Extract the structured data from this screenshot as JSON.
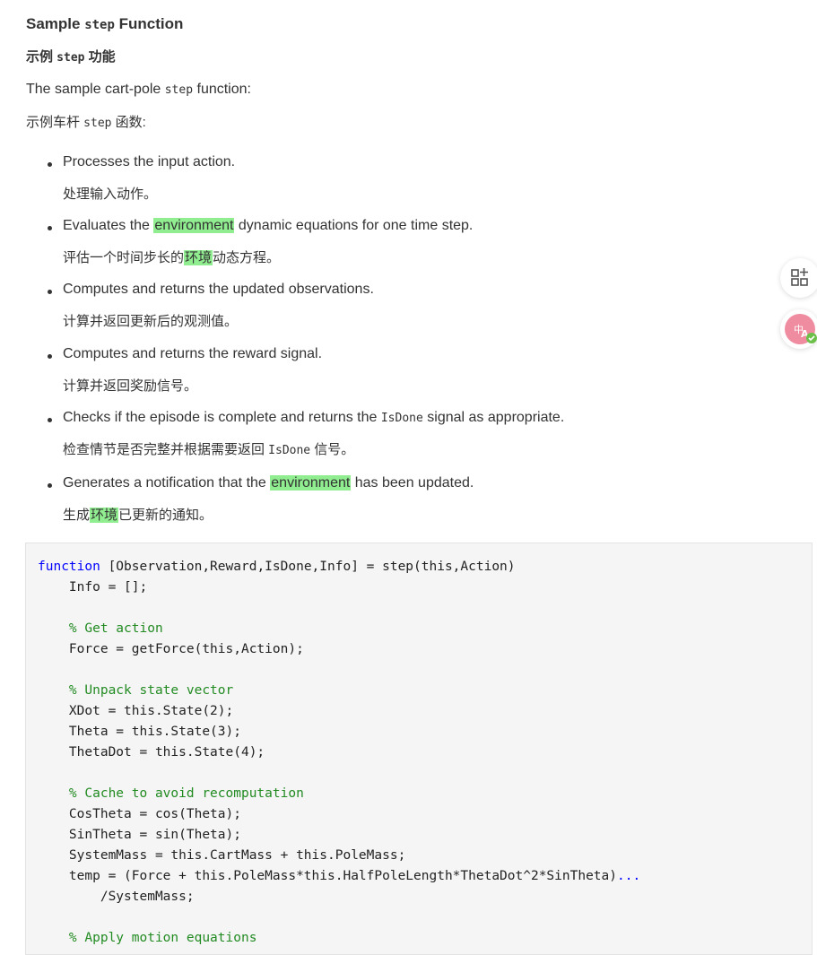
{
  "heading": {
    "en_before": "Sample ",
    "en_code": "step",
    "en_after": " Function",
    "zh_before": "示例 ",
    "zh_code": "step",
    "zh_after": " 功能"
  },
  "intro": {
    "en_before": "The sample cart-pole ",
    "en_code": "step",
    "en_after": " function:",
    "zh_before": "示例车杆 ",
    "zh_code": "step",
    "zh_after": " 函数:"
  },
  "bullets": [
    {
      "en": "Processes the input action.",
      "zh": "处理输入动作。"
    },
    {
      "en_before": "Evaluates the ",
      "en_mark": "environment",
      "en_after": " dynamic equations for one time step.",
      "zh_before": "评估一个时间步长的",
      "zh_mark": "环境",
      "zh_after": "动态方程。"
    },
    {
      "en": "Computes and returns the updated observations.",
      "zh": "计算并返回更新后的观测值。"
    },
    {
      "en": "Computes and returns the reward signal.",
      "zh": "计算并返回奖励信号。"
    },
    {
      "en_before": "Checks if the episode is complete and returns the ",
      "en_code": "IsDone",
      "en_after": " signal as appropriate.",
      "zh_before": "检查情节是否完整并根据需要返回 ",
      "zh_code": "IsDone",
      "zh_after": " 信号。"
    },
    {
      "en_before": "Generates a notification that the ",
      "en_mark": "environment",
      "en_after": " has been updated.",
      "zh_before": "生成",
      "zh_mark": "环境",
      "zh_after": "已更新的通知。"
    }
  ],
  "code": {
    "l1_kw": "function",
    "l1_rest": " [Observation,Reward,IsDone,Info] = step(this,Action)",
    "l2": "    Info = [];",
    "l3": "",
    "l4": "    % Get action",
    "l5": "    Force = getForce(this,Action);",
    "l6": "",
    "l7": "    % Unpack state vector",
    "l8": "    XDot = this.State(2);",
    "l9": "    Theta = this.State(3);",
    "l10": "    ThetaDot = this.State(4);",
    "l11": "",
    "l12": "    % Cache to avoid recomputation",
    "l13": "    CosTheta = cos(Theta);",
    "l14": "    SinTheta = sin(Theta);",
    "l15": "    SystemMass = this.CartMass + this.PoleMass;",
    "l16_main": "    temp = (Force + this.PoleMass*this.HalfPoleLength*ThetaDot^2*SinTheta)",
    "l16_cont": "...",
    "l17": "        /SystemMass;",
    "l18": "",
    "l19": "    % Apply motion equations"
  },
  "colors": {
    "highlight": "#90ee90",
    "keyword": "#0000ff",
    "comment": "#228b22",
    "code_bg": "#f5f5f5",
    "translate_icon": "#f08ca0",
    "check_badge": "#6cc04a"
  },
  "icons": {
    "tools": "add-tools-icon",
    "translate": "translate-icon"
  }
}
